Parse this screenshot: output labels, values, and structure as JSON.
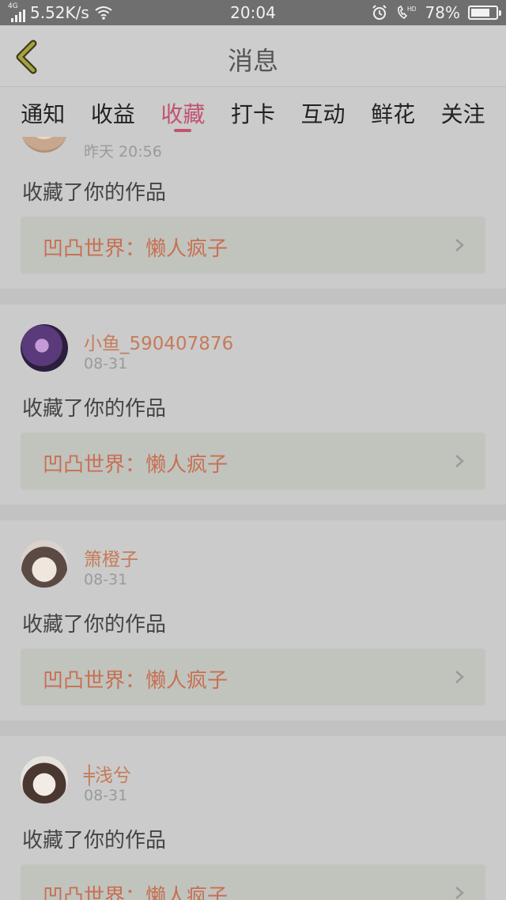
{
  "status_bar": {
    "network_type": "4G",
    "speed": "5.52K/s",
    "time": "20:04",
    "battery": "78%",
    "battery_level": 0.78
  },
  "header": {
    "title": "消息"
  },
  "tabs": [
    {
      "label": "通知",
      "active": false
    },
    {
      "label": "收益",
      "active": false
    },
    {
      "label": "收藏",
      "active": true
    },
    {
      "label": "打卡",
      "active": false
    },
    {
      "label": "互动",
      "active": false
    },
    {
      "label": "鲜花",
      "active": false
    },
    {
      "label": "关注",
      "active": false
    }
  ],
  "items": [
    {
      "username": "",
      "time": "昨天 20:56",
      "action": "收藏了你的作品",
      "work_title": "凹凸世界：懒人疯子"
    },
    {
      "username": "小鱼_590407876",
      "time": "08-31",
      "action": "收藏了你的作品",
      "work_title": "凹凸世界：懒人疯子"
    },
    {
      "username": "箫橙子",
      "time": "08-31",
      "action": "收藏了你的作品",
      "work_title": "凹凸世界：懒人疯子"
    },
    {
      "username": "╪浅兮",
      "time": "08-31",
      "action": "收藏了你的作品",
      "work_title": "凹凸世界：懒人疯子"
    }
  ],
  "colors": {
    "accent": "#c25371",
    "username": "#c57b5a",
    "work_title": "#c86f54"
  }
}
